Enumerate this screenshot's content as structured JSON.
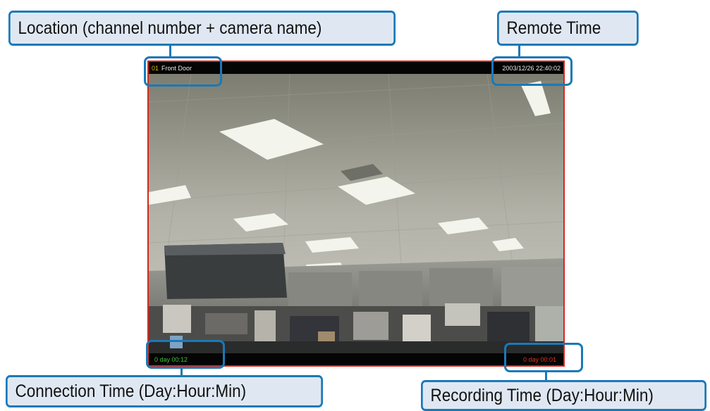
{
  "callouts": {
    "location": "Location (channel number + camera name)",
    "remote_time": "Remote Time",
    "connection_time": "Connection Time (Day:Hour:Min)",
    "recording_time": "Recording Time (Day:Hour:Min)"
  },
  "video": {
    "channel_number": "01",
    "camera_name": "Front Door",
    "remote_time": "2003/12/26 22:40:02",
    "connection_time": "0 day  00:12",
    "recording_time": "0 day  00:01"
  },
  "colors": {
    "callout_border": "#1a79b8",
    "callout_fill": "#dfe8f2",
    "frame_border": "#d4281e",
    "channel_number": "#e2b400",
    "connection_time": "#39c634",
    "recording_time": "#e0331e"
  }
}
